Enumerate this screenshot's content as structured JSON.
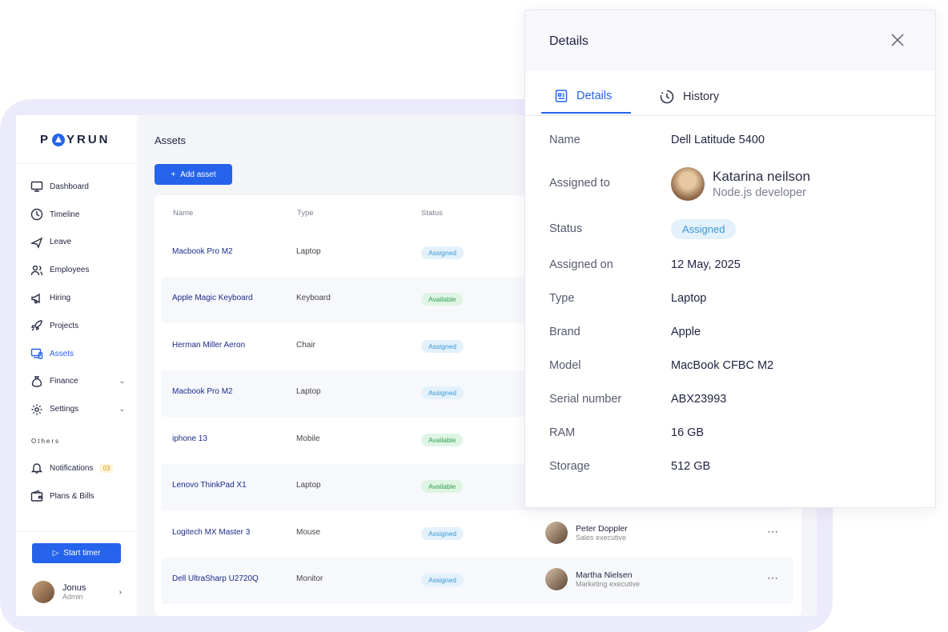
{
  "sidebar": {
    "logo_text": "PAYRUN",
    "nav": [
      {
        "label": "Dashboard",
        "icon": "monitor-icon"
      },
      {
        "label": "Timeline",
        "icon": "clock-icon"
      },
      {
        "label": "Leave",
        "icon": "plane-icon"
      },
      {
        "label": "Employees",
        "icon": "users-icon"
      },
      {
        "label": "Hiring",
        "icon": "megaphone-icon"
      },
      {
        "label": "Projects",
        "icon": "rocket-icon"
      },
      {
        "label": "Assets",
        "icon": "devices-icon",
        "active": true
      },
      {
        "label": "Finance",
        "icon": "money-bag-icon"
      },
      {
        "label": "Settings",
        "icon": "gear-icon"
      }
    ],
    "section_label": "Others",
    "nav2": [
      {
        "label": "Notifications",
        "badge": "03"
      },
      {
        "label": "Plans & Bills"
      }
    ],
    "timer_label": "Start timer",
    "user": {
      "name": "Jonus",
      "role": "Admin"
    }
  },
  "main": {
    "title": "Assets",
    "add_label": "Add asset",
    "columns": [
      "Name",
      "Type",
      "Status"
    ],
    "rows": [
      {
        "name": "Macbook Pro M2",
        "type": "Laptop",
        "status": "Assigned"
      },
      {
        "name": "Apple Magic Keyboard",
        "type": "Keyboard",
        "status": "Available"
      },
      {
        "name": "Herman Miller Aeron",
        "type": "Chair",
        "status": "Assigned"
      },
      {
        "name": "Macbook Pro M2",
        "type": "Laptop",
        "status": "Assigned"
      },
      {
        "name": "iphone 13",
        "type": "Mobile",
        "status": "Available"
      },
      {
        "name": "Lenovo ThinkPad X1",
        "type": "Laptop",
        "status": "Available"
      },
      {
        "name": "Logitech MX Master 3",
        "type": "Mouse",
        "status": "Assigned",
        "person": "Peter Doppler",
        "role": "Sales executive"
      },
      {
        "name": "Dell UltraSharp U2720Q",
        "type": "Monitor",
        "status": "Assigned",
        "person": "Martha Nielsen",
        "role": "Marketing executive"
      }
    ]
  },
  "panel": {
    "title": "Details",
    "tabs": [
      "Details",
      "History"
    ],
    "name_label": "Name",
    "name_value": "Dell Latitude 5400",
    "assigned_to_label": "Assigned to",
    "assignee_name": "Katarina neilson",
    "assignee_role": "Node.js developer",
    "status_label": "Status",
    "status_value": "Assigned",
    "assigned_on_label": "Assigned on",
    "assigned_on_value": "12 May, 2025",
    "type_label": "Type",
    "type_value": "Laptop",
    "brand_label": "Brand",
    "brand_value": "Apple",
    "model_label": "Model",
    "model_value": "MacBook CFBC M2",
    "serial_label": "Serial number",
    "serial_value": "ABX23993",
    "ram_label": "RAM",
    "ram_value": "16 GB",
    "storage_label": "Storage",
    "storage_value": "512 GB"
  },
  "colors": {
    "accent": "#2563eb",
    "assigned": "#3c98d2",
    "available": "#2e9e4e"
  }
}
